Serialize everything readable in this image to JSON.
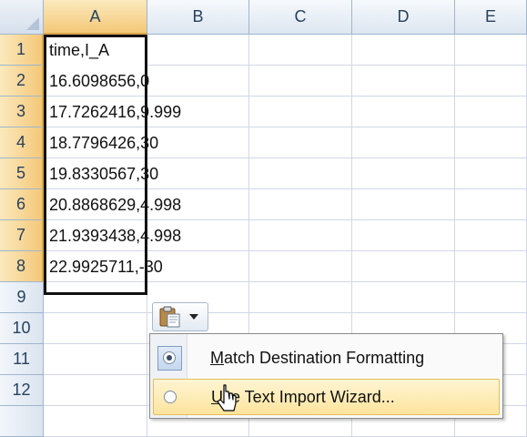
{
  "columns": [
    "A",
    "B",
    "C",
    "D",
    "E"
  ],
  "rows": [
    "1",
    "2",
    "3",
    "4",
    "5",
    "6",
    "7",
    "8",
    "9",
    "10",
    "11",
    "12"
  ],
  "cells": [
    "time,I_A",
    "16.6098656,0",
    "17.7262416,9.999",
    "18.7796426,30",
    "19.8330567,30",
    "20.8868629,4.998",
    "21.9393438,4.998",
    "22.9925711,-30"
  ],
  "paste_options": {
    "icon": "clipboard-paste-icon",
    "items": [
      {
        "label_accel": "M",
        "label_rest": "atch Destination Formatting",
        "selected": true
      },
      {
        "label_accel": "U",
        "label_rest": "se Text Import Wizard...",
        "selected": false
      }
    ]
  },
  "colors": {
    "selected_header": "#f4c878",
    "menu_highlight": "#fde49d",
    "grid_line": "#d0d7e5"
  }
}
